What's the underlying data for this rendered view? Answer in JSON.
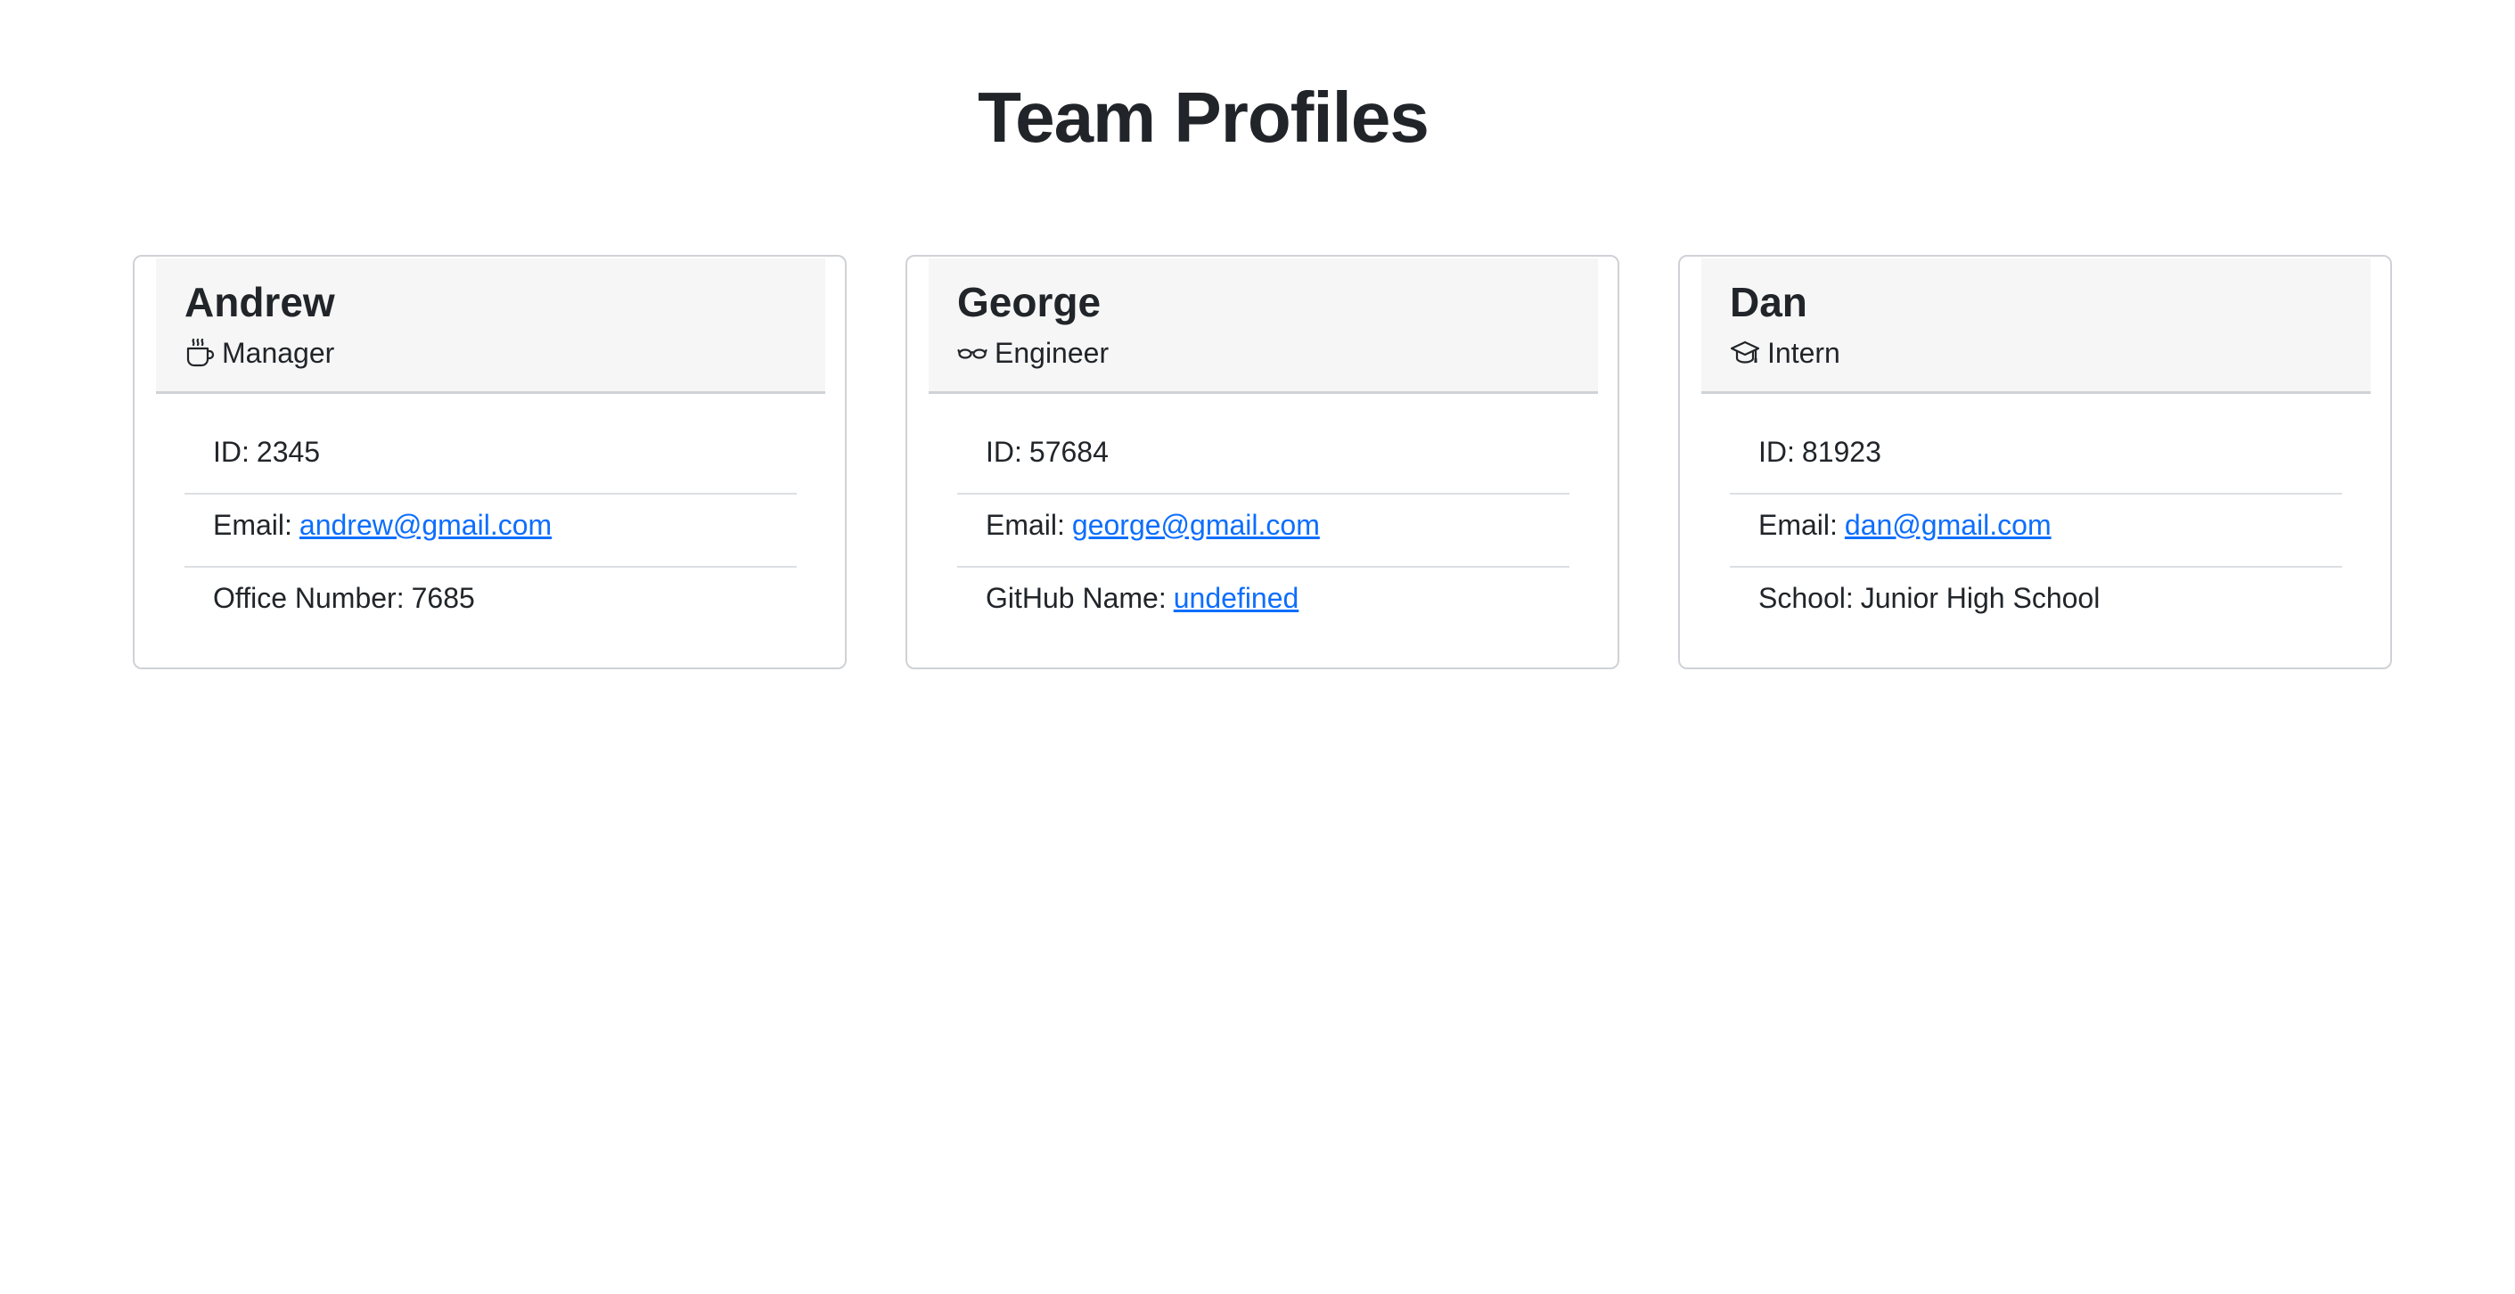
{
  "page": {
    "title": "Team Profiles"
  },
  "colors": {
    "link": "#0d6efd",
    "header_bg": "#f6f6f6",
    "border": "#cfd2d6",
    "text": "#212529"
  },
  "members": [
    {
      "name": "Andrew",
      "role": "Manager",
      "role_icon": "coffee-mug-icon",
      "id_label": "ID:",
      "id_value": "2345",
      "email_label": "Email:",
      "email": "andrew@gmail.com",
      "extra_label": "Office Number:",
      "extra_value": "7685"
    },
    {
      "name": "George",
      "role": "Engineer",
      "role_icon": "glasses-icon",
      "id_label": "ID:",
      "id_value": "57684",
      "email_label": "Email:",
      "email": "george@gmail.com",
      "extra_label": "GitHub Name:",
      "extra_value": "undefined"
    },
    {
      "name": "Dan",
      "role": "Intern",
      "role_icon": "graduation-cap-icon",
      "id_label": "ID:",
      "id_value": "81923",
      "email_label": "Email:",
      "email": "dan@gmail.com",
      "extra_label": "School:",
      "extra_value": "Junior High School"
    }
  ]
}
